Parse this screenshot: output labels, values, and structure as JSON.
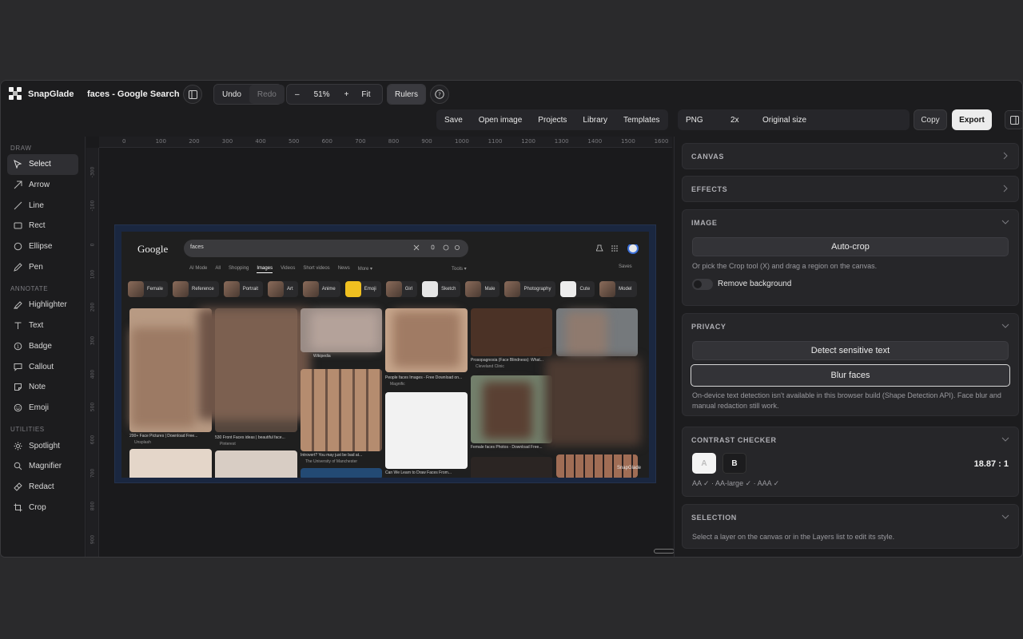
{
  "app": {
    "name": "SnapGlade",
    "doc_title": "faces - Google Search"
  },
  "toolbar": {
    "undo": "Undo",
    "redo": "Redo",
    "zoom_out": "–",
    "zoom_level": "51%",
    "zoom_in": "+",
    "fit": "Fit",
    "rulers": "Rulers",
    "menu": [
      "Save",
      "Open image",
      "Projects",
      "Library",
      "Templates"
    ],
    "format": "PNG",
    "scale": "2x",
    "size_option": "Original size",
    "copy": "Copy",
    "export": "Export"
  },
  "sidebar": {
    "draw_label": "DRAW",
    "draw": [
      {
        "label": "Select",
        "icon": "cursor-icon"
      },
      {
        "label": "Arrow",
        "icon": "arrow-icon"
      },
      {
        "label": "Line",
        "icon": "line-icon"
      },
      {
        "label": "Rect",
        "icon": "rect-icon"
      },
      {
        "label": "Ellipse",
        "icon": "ellipse-icon"
      },
      {
        "label": "Pen",
        "icon": "pen-icon"
      }
    ],
    "annotate_label": "ANNOTATE",
    "annotate": [
      {
        "label": "Highlighter",
        "icon": "highlighter-icon"
      },
      {
        "label": "Text",
        "icon": "text-icon"
      },
      {
        "label": "Badge",
        "icon": "badge-icon"
      },
      {
        "label": "Callout",
        "icon": "callout-icon"
      },
      {
        "label": "Note",
        "icon": "note-icon"
      },
      {
        "label": "Emoji",
        "icon": "emoji-icon"
      }
    ],
    "utilities_label": "UTILITIES",
    "utilities": [
      {
        "label": "Spotlight",
        "icon": "spotlight-icon"
      },
      {
        "label": "Magnifier",
        "icon": "magnifier-icon"
      },
      {
        "label": "Redact",
        "icon": "redact-icon"
      },
      {
        "label": "Crop",
        "icon": "crop-icon"
      }
    ]
  },
  "rulers": {
    "top": [
      "0",
      "100",
      "200",
      "300",
      "400",
      "500",
      "600",
      "700",
      "800",
      "900",
      "1000",
      "1100",
      "1200",
      "1300",
      "1400",
      "1500",
      "1600"
    ],
    "left": [
      "-300",
      "-100",
      "0",
      "100",
      "200",
      "300",
      "400",
      "500",
      "600",
      "700",
      "800",
      "900"
    ]
  },
  "screenshot": {
    "logo": "Google",
    "query": "faces",
    "tabs": [
      "AI Mode",
      "All",
      "Shopping",
      "Images",
      "Videos",
      "Short videos",
      "News",
      "More ▾"
    ],
    "active_tab": "Images",
    "tools": "Tools ▾",
    "saves": "Saves",
    "chips": [
      "Female",
      "Reference",
      "Portrait",
      "Art",
      "Anime",
      "Emoji",
      "Girl",
      "Sketch",
      "Male",
      "Photography",
      "Cute",
      "Model"
    ],
    "captions": [
      "200+ Face Pictures | Download Free...",
      "Unsplash",
      "530 Front Faces ideas | beautiful face...",
      "Pinterest",
      "Wikipedia",
      "Introvert? You may just be bad at...",
      "The University of Manchester",
      "People faces Images - Free Download on...",
      "Magnific",
      "Can We Learn to Draw Faces From...",
      "Prosopagnosia (Face Blindness): What...",
      "Cleveland Clinic",
      "Female faces Photos - Download Free...",
      "SnapGlade"
    ]
  },
  "panel": {
    "canvas": "CANVAS",
    "effects": "EFFECTS",
    "image": "IMAGE",
    "autocrop": "Auto-crop",
    "autocrop_hint": "Or pick the Crop tool (X) and drag a region on the canvas.",
    "remove_bg": "Remove background",
    "privacy": "PRIVACY",
    "detect": "Detect sensitive text",
    "blur": "Blur faces",
    "privacy_hint": "On-device text detection isn't available in this browser build (Shape Detection API). Face blur and manual redaction still work.",
    "contrast": "CONTRAST CHECKER",
    "swatch_a": "A",
    "swatch_b": "B",
    "ratio": "18.87 : 1",
    "checks": "AA ✓ · AA-large ✓ · AAA ✓",
    "selection": "SELECTION",
    "selection_hint": "Select a layer on the canvas or in the Layers list to edit its style."
  }
}
